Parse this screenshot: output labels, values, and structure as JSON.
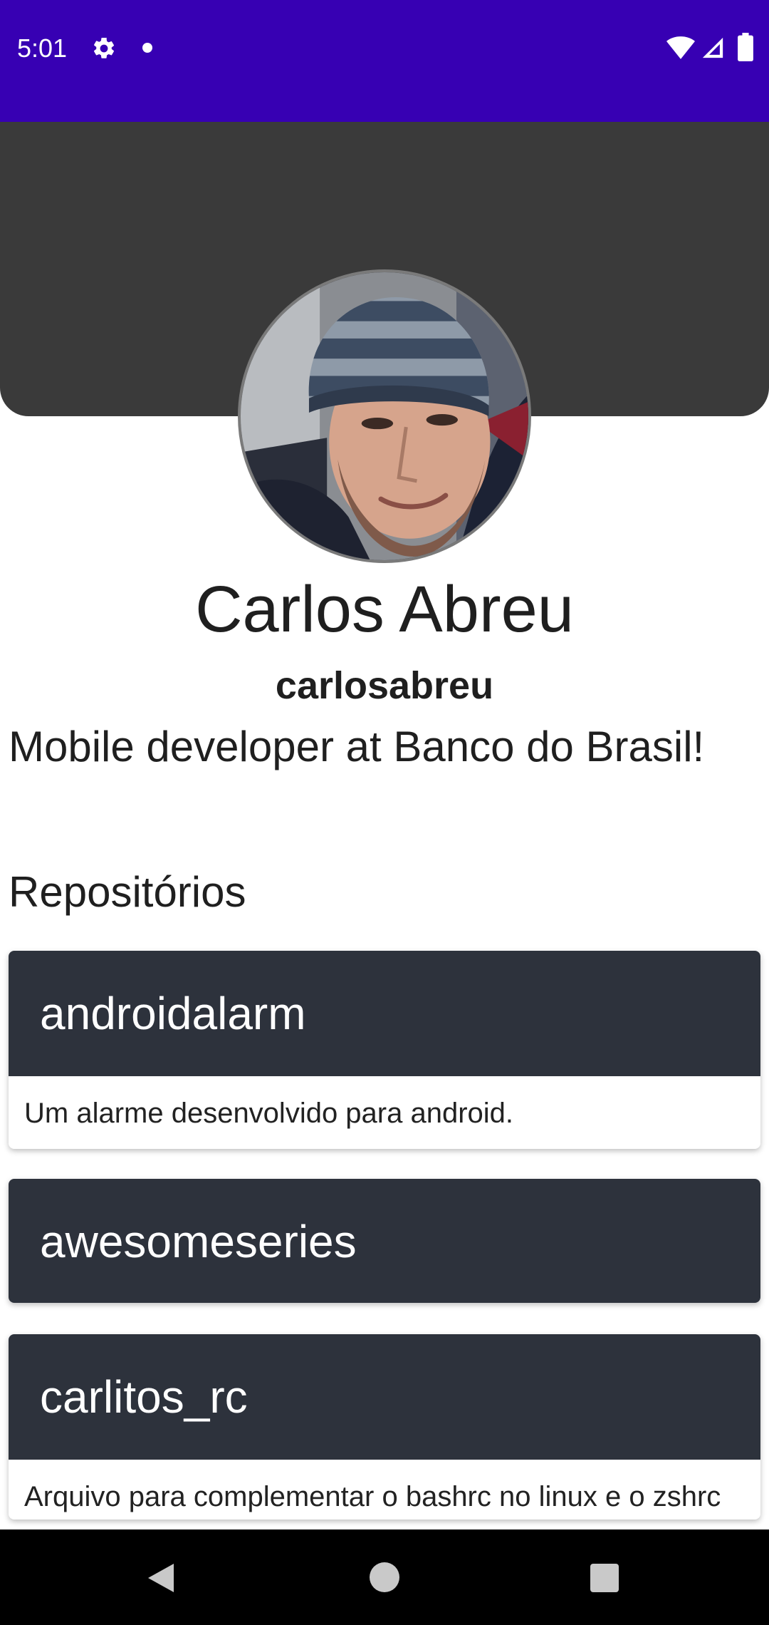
{
  "status_bar": {
    "time": "5:01",
    "background_color": "#3700B3",
    "icons": [
      "gear-icon",
      "notification-dot-icon",
      "wifi-icon",
      "signal-icon",
      "battery-icon"
    ]
  },
  "header": {
    "background_color": "#3a3a3a"
  },
  "profile": {
    "name": "Carlos Abreu",
    "login": "carlosabreu",
    "bio": "Mobile developer at Banco do Brasil!"
  },
  "repositories": {
    "title": "Repositórios",
    "card_header_color": "#2d323c",
    "items": [
      {
        "name": "androidalarm",
        "description": "Um alarme desenvolvido para android."
      },
      {
        "name": "awesomeseries",
        "description": ""
      },
      {
        "name": "carlitos_rc",
        "description": "Arquivo para complementar o bashrc no linux e o zshrc no mac que eu uso. Sim, sim, eu entendo que"
      }
    ]
  },
  "nav_bar": {
    "buttons": [
      "back-icon",
      "home-icon",
      "recents-icon"
    ]
  }
}
